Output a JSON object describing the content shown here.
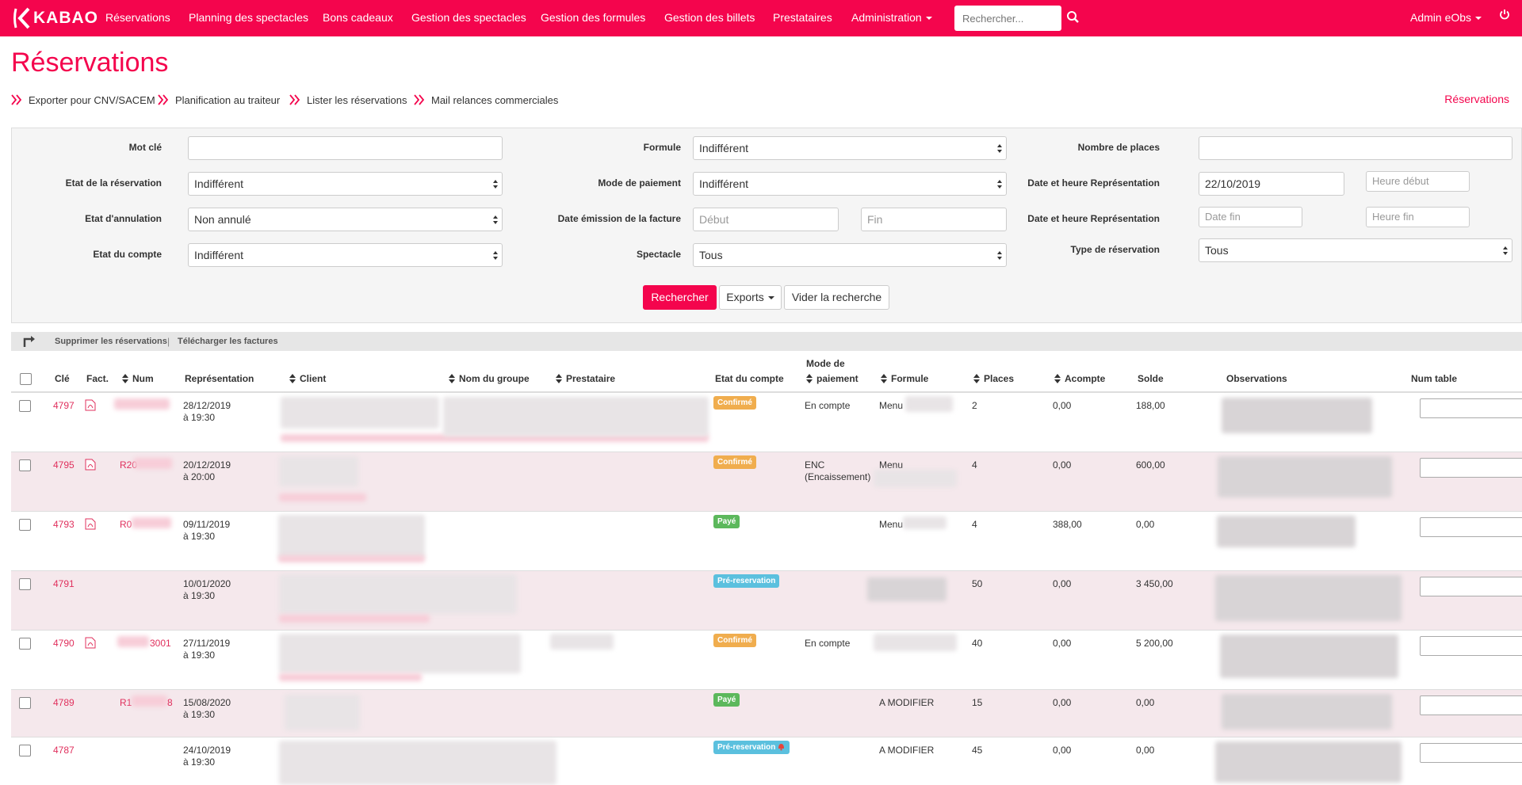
{
  "nav": {
    "logo_text": "KABAO",
    "items": [
      {
        "label": "Réservations"
      },
      {
        "label": "Planning des spectacles"
      },
      {
        "label": "Bons cadeaux"
      },
      {
        "label": "Gestion des spectacles"
      },
      {
        "label": "Gestion des formules"
      },
      {
        "label": "Gestion des billets"
      },
      {
        "label": "Prestataires"
      },
      {
        "label": "Administration"
      }
    ],
    "search_placeholder": "Rechercher...",
    "user_label": "Admin eObs"
  },
  "page": {
    "title": "Réservations",
    "breadcrumb": "Réservations",
    "sublinks": [
      {
        "label": "Exporter pour CNV/SACEM"
      },
      {
        "label": "Planification au traiteur"
      },
      {
        "label": "Lister les réservations"
      },
      {
        "label": "Mail relances commerciales"
      }
    ]
  },
  "filters": {
    "mot_cle": {
      "label": "Mot clé",
      "value": ""
    },
    "formule": {
      "label": "Formule",
      "value": "Indifférent"
    },
    "nombre_places": {
      "label": "Nombre de places",
      "value": ""
    },
    "etat_reservation": {
      "label": "Etat de la réservation",
      "value": "Indifférent"
    },
    "mode_paiement": {
      "label": "Mode de paiement",
      "value": "Indifférent"
    },
    "date_representation": {
      "label": "Date et heure Représentation",
      "value": "22/10/2019",
      "heure_placeholder": "Heure début"
    },
    "etat_annulation": {
      "label": "Etat d'annulation",
      "value": "Non annulé"
    },
    "date_facture": {
      "label": "Date émission de la facture",
      "debut_placeholder": "Début",
      "fin_placeholder": "Fin"
    },
    "date_representation_fin": {
      "label": "Date et heure Représentation",
      "date_placeholder": "Date fin",
      "heure_placeholder": "Heure fin"
    },
    "etat_compte": {
      "label": "Etat du compte",
      "value": "Indifférent"
    },
    "spectacle": {
      "label": "Spectacle",
      "value": "Tous"
    },
    "type_reservation": {
      "label": "Type de réservation",
      "value": "Tous"
    },
    "buttons": {
      "search": "Rechercher",
      "exports": "Exports",
      "clear": "Vider la recherche"
    }
  },
  "bulk": {
    "delete": "Supprimer les réservations",
    "separator": "|",
    "download": "Télécharger les factures"
  },
  "table": {
    "headers": {
      "cle": "Clé",
      "fact": "Fact.",
      "num": "Num",
      "representation": "Représentation",
      "client": "Client",
      "nom_groupe": "Nom du groupe",
      "prestataire": "Prestataire",
      "etat_compte": "Etat du compte",
      "mode_paiement_1": "Mode de",
      "mode_paiement_2": "paiement",
      "formule": "Formule",
      "places": "Places",
      "acompte": "Acompte",
      "solde": "Solde",
      "observations": "Observations",
      "num_table": "Num table"
    },
    "rows": [
      {
        "cle": "4797",
        "num": "",
        "date": "28/12/2019",
        "heure": "à 19:30",
        "etat": "Confirmé",
        "mode1": "En compte",
        "mode2": "",
        "formule": "Menu",
        "places": "2",
        "acompte": "0,00",
        "solde": "188,00"
      },
      {
        "cle": "4795",
        "num": "R20",
        "date": "20/12/2019",
        "heure": "à 20:00",
        "etat": "Confirmé",
        "mode1": "ENC",
        "mode2": "(Encaissement)",
        "formule": "Menu",
        "places": "4",
        "acompte": "0,00",
        "solde": "600,00"
      },
      {
        "cle": "4793",
        "num": "R0",
        "date": "09/11/2019",
        "heure": "à 19:30",
        "etat": "Payé",
        "mode1": "",
        "mode2": "",
        "formule": "Menu",
        "places": "4",
        "acompte": "388,00",
        "solde": "0,00"
      },
      {
        "cle": "4791",
        "num": "",
        "date": "10/01/2020",
        "heure": "à 19:30",
        "etat": "Pré-reservation",
        "mode1": "",
        "mode2": "",
        "formule": "",
        "places": "50",
        "acompte": "0,00",
        "solde": "3 450,00"
      },
      {
        "cle": "4790",
        "num": "3001",
        "date": "27/11/2019",
        "heure": "à 19:30",
        "etat": "Confirmé",
        "mode1": "En compte",
        "mode2": "",
        "formule": "",
        "places": "40",
        "acompte": "0,00",
        "solde": "5 200,00"
      },
      {
        "cle": "4789",
        "num": "R1",
        "num_suffix": "8",
        "date": "15/08/2020",
        "heure": "à 19:30",
        "etat": "Payé",
        "mode1": "",
        "mode2": "",
        "formule": "A MODIFIER",
        "places": "15",
        "acompte": "0,00",
        "solde": "0,00"
      },
      {
        "cle": "4787",
        "num": "",
        "date": "24/10/2019",
        "heure": "à 19:30",
        "etat": "Pré-reservation",
        "mode1": "",
        "mode2": "",
        "formule": "A MODIFIER",
        "places": "45",
        "acompte": "0,00",
        "solde": "0,00"
      }
    ]
  },
  "colors": {
    "brand": "#f4054d",
    "confirme": "#f0ad4e",
    "paye": "#5cb85c",
    "prereservation": "#5bc0de",
    "row_alt": "#f5e8ec"
  },
  "icons": {
    "logo": "kabao-logo-icon",
    "search": "search-icon",
    "power": "power-icon",
    "sublink": "double-chevron-right-icon",
    "bulk": "turn-arrow-icon",
    "pdf": "pdf-icon",
    "sort": "sort-icon",
    "bell": "bell-icon"
  }
}
